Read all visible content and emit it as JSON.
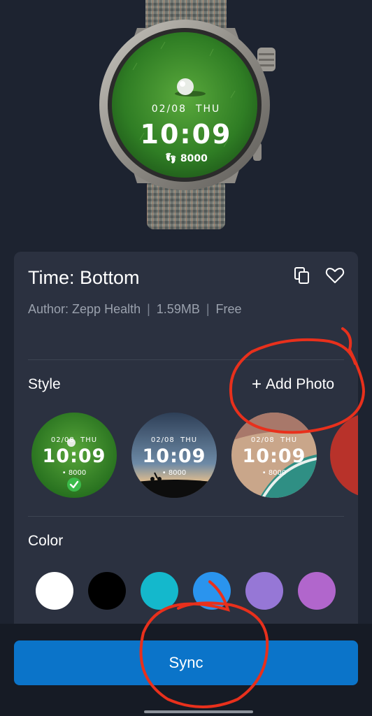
{
  "watch_preview": {
    "date": "02/08",
    "weekday": "THU",
    "time": "10:09",
    "steps": "8000"
  },
  "card": {
    "title": "Time: Bottom",
    "author": "Author: Zepp Health",
    "size": "1.59MB",
    "price": "Free",
    "separator": "|",
    "icons": {
      "copy": "copy-icon",
      "favorite": "heart-outline-icon"
    }
  },
  "style_section": {
    "label": "Style",
    "add_photo_label": "Add Photo",
    "add_photo_icon": "+",
    "options": [
      {
        "name": "grass",
        "date": "02/08",
        "weekday": "THU",
        "time": "10:09",
        "steps": "8000",
        "selected": true
      },
      {
        "name": "sunset",
        "date": "02/08",
        "weekday": "THU",
        "time": "10:09",
        "steps": "8000",
        "selected": false
      },
      {
        "name": "beach",
        "date": "02/08",
        "weekday": "THU",
        "time": "10:09",
        "steps": "8000",
        "selected": false
      }
    ]
  },
  "color_section": {
    "label": "Color",
    "swatches": [
      "#ffffff",
      "#000000",
      "#14b8cc",
      "#2a94ee",
      "#9677d6",
      "#b166cc"
    ]
  },
  "sync_button": {
    "label": "Sync"
  },
  "colors": {
    "accent": "#0b74c9",
    "background": "#1d2330",
    "card": "#2b3140",
    "annotation": "#e8301c"
  }
}
